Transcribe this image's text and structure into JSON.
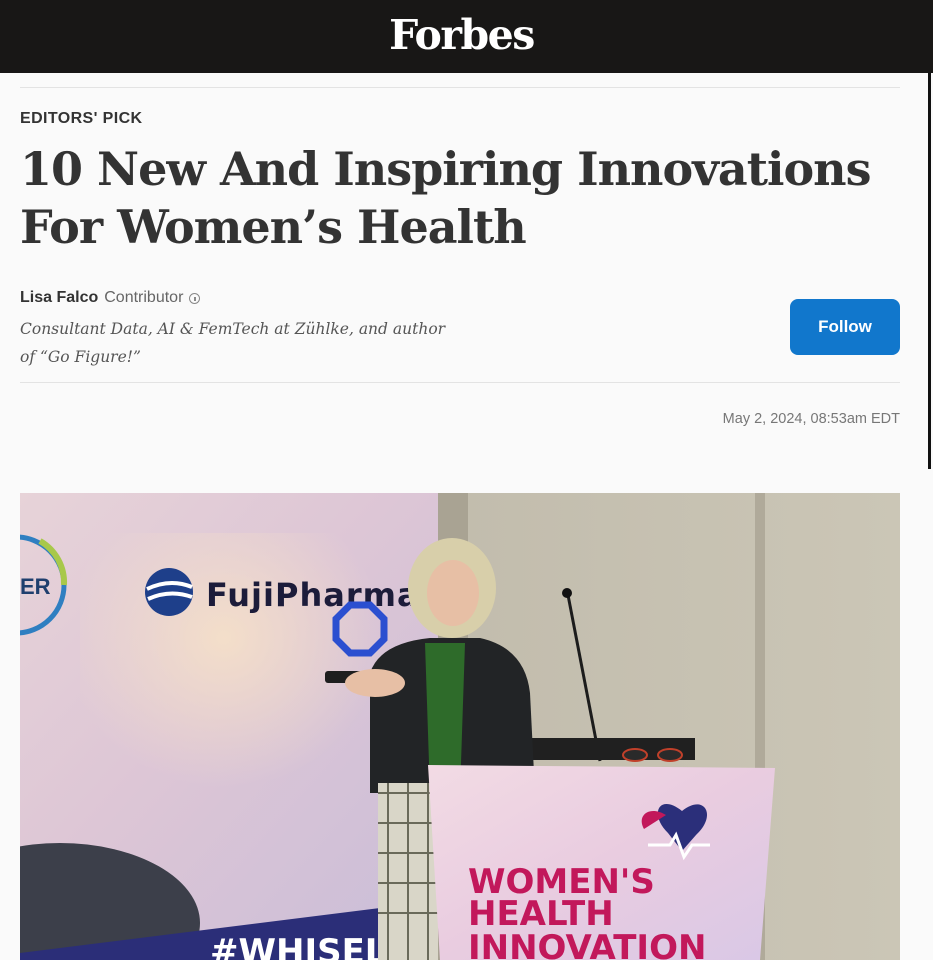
{
  "header": {
    "logo_text": "Forbes"
  },
  "article": {
    "kicker": "EDITORS' PICK",
    "headline_line1": "10 New And Inspiring Innovations",
    "headline_line2": "For Women’s Health",
    "author": {
      "name": "Lisa Falco",
      "role": "Contributor",
      "bio_line1": "Consultant Data, AI & FemTech at Zühlke, and author",
      "bio_line2": "of “Go Figure!”"
    },
    "follow_label": "Follow",
    "timestamp": "May 2, 2024, 08:53am EDT"
  },
  "hero_image": {
    "sponsor_text": "FujiPharma",
    "sponsor_partial": "ER",
    "banner_line1": "WOMEN'S",
    "banner_line2": "HEALTH",
    "banner_line3": "INNOVATION",
    "hashtag_partial": "#WHISEL"
  },
  "colors": {
    "topbar": "#181716",
    "follow_button": "#1177cc",
    "banner_text": "#c2185b"
  }
}
